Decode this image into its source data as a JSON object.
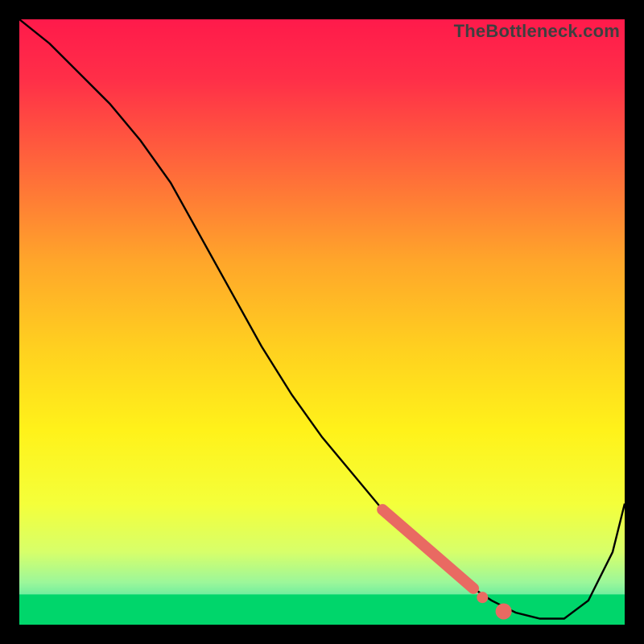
{
  "watermark": "TheBottleneck.com",
  "chart_data": {
    "type": "line",
    "title": "",
    "xlabel": "",
    "ylabel": "",
    "xlim": [
      0,
      100
    ],
    "ylim": [
      0,
      100
    ],
    "grid": false,
    "legend": false,
    "series": [
      {
        "name": "curve",
        "x": [
          0,
          5,
          10,
          15,
          20,
          25,
          30,
          35,
          40,
          45,
          50,
          55,
          60,
          65,
          70,
          75,
          78,
          82,
          86,
          90,
          94,
          98,
          100
        ],
        "y": [
          100,
          96,
          91,
          86,
          80,
          73,
          64,
          55,
          46,
          38,
          31,
          25,
          19,
          14,
          10,
          6,
          4,
          2,
          1,
          1,
          4,
          12,
          20
        ]
      }
    ],
    "highlight_segment": {
      "description": "thick coral segment near trough",
      "x": [
        60,
        75
      ],
      "y": [
        19,
        6
      ]
    },
    "highlight_dots": [
      {
        "x": 76.5,
        "y": 4.5
      },
      {
        "x": 80.0,
        "y": 2.2
      }
    ],
    "green_band": {
      "y_from": 0,
      "y_to": 5,
      "color_top": "#3be38a",
      "color_bottom": "#00d66b"
    },
    "gradient_stops": [
      {
        "offset": 0.0,
        "color": "#ff1a4b"
      },
      {
        "offset": 0.1,
        "color": "#ff2f48"
      },
      {
        "offset": 0.25,
        "color": "#ff6a3a"
      },
      {
        "offset": 0.4,
        "color": "#ffa62a"
      },
      {
        "offset": 0.55,
        "color": "#ffd21f"
      },
      {
        "offset": 0.68,
        "color": "#fff21a"
      },
      {
        "offset": 0.8,
        "color": "#f4ff3a"
      },
      {
        "offset": 0.88,
        "color": "#d7ff6a"
      },
      {
        "offset": 0.93,
        "color": "#9cf79a"
      },
      {
        "offset": 0.96,
        "color": "#5ceaa0"
      },
      {
        "offset": 1.0,
        "color": "#00d66b"
      }
    ],
    "curve_color": "#000000",
    "highlight_color": "#e96a62"
  }
}
